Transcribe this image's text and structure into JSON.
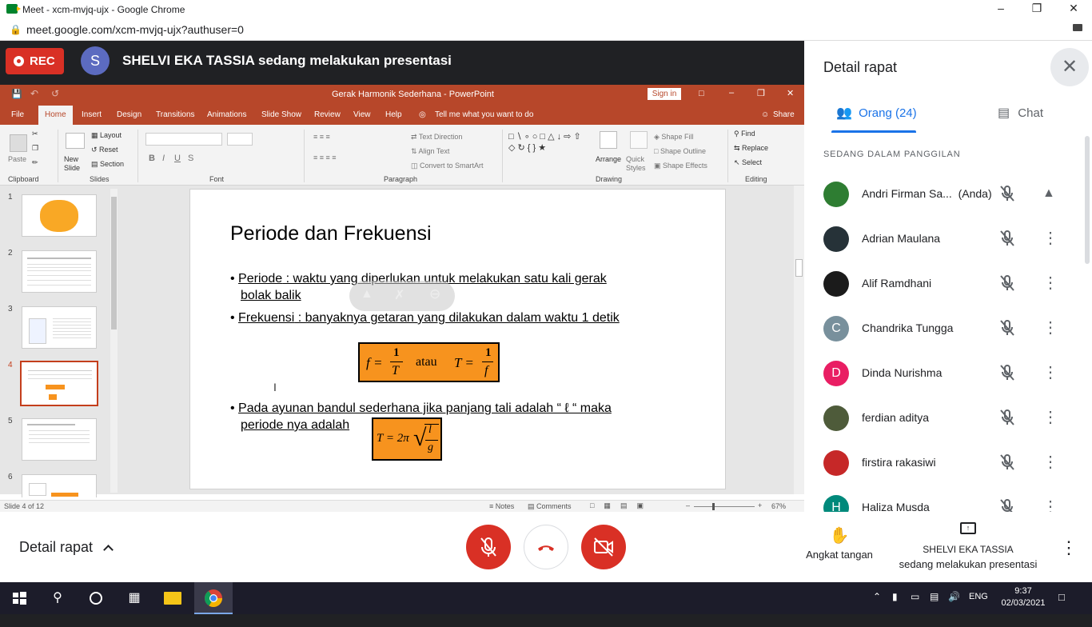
{
  "browser": {
    "title": "Meet - xcm-mvjq-ujx - Google Chrome",
    "url": "meet.google.com/xcm-mvjq-ujx?authuser=0"
  },
  "meet": {
    "rec_label": "REC",
    "presenter_initial": "S",
    "presenter_banner": "SHELVI EKA TASSIA sedang melakukan presentasi"
  },
  "ppt": {
    "window_title": "Gerak Harmonik Sederhana  -  PowerPoint",
    "sign_in": "Sign in",
    "tabs": [
      "File",
      "Home",
      "Insert",
      "Design",
      "Transitions",
      "Animations",
      "Slide Show",
      "Review",
      "View",
      "Help"
    ],
    "tell_me": "Tell me what you want to do",
    "share": "Share",
    "ribbon": {
      "paste": "Paste",
      "new_slide": "New Slide",
      "layout": "Layout",
      "reset": "Reset",
      "section": "Section",
      "text_direction": "Text Direction",
      "align_text": "Align Text",
      "convert_smartart": "Convert to SmartArt",
      "arrange": "Arrange",
      "quick_styles": "Quick Styles",
      "shape_fill": "Shape Fill",
      "shape_outline": "Shape Outline",
      "shape_effects": "Shape Effects",
      "find": "Find",
      "replace": "Replace",
      "select": "Select",
      "groups": [
        "Clipboard",
        "Slides",
        "Font",
        "Paragraph",
        "Drawing",
        "Editing"
      ]
    },
    "thumb_numbers": [
      "1",
      "2",
      "3",
      "4",
      "5",
      "6"
    ],
    "slide": {
      "title": "Periode dan Frekuensi",
      "b1_term": "Periode",
      "b1_rest": " : waktu yang diperlukan untuk melakukan satu kali gerak",
      "b1_line2": "bolak balik",
      "b2_term": "Frekuensi",
      "b2_rest": " : banyaknya getaran yang dilakukan dalam waktu 1 detik",
      "formula_f": "f =",
      "formula_num": "1",
      "formula_den_T": "T",
      "formula_atau": "atau",
      "formula_T": "T =",
      "formula_den_f": "f",
      "b3_line1": "Pada ayunan bandul sederhana jika panjang tali adalah “ ℓ “ maka",
      "b3_line2": "periode nya adalah",
      "pendulum_T": "T = 2π",
      "pendulum_l": "l",
      "pendulum_g": "g"
    },
    "status": {
      "slide_count": "Slide 4 of 12",
      "notes": "Notes",
      "comments": "Comments",
      "zoom": "67%"
    }
  },
  "panel": {
    "title": "Detail rapat",
    "tab_people": "Orang (24)",
    "tab_chat": "Chat",
    "section": "SEDANG DALAM PANGGILAN",
    "participants": [
      {
        "name": "Andri Firman Sa...",
        "suffix": "(Anda)",
        "initial": "",
        "color": "#2e7d32"
      },
      {
        "name": "Adrian Maulana",
        "initial": "",
        "color": "#263238"
      },
      {
        "name": "Alif Ramdhani",
        "initial": "",
        "color": "#1b1b1b"
      },
      {
        "name": "Chandrika Tungga",
        "initial": "C",
        "color": "#78909c"
      },
      {
        "name": "Dinda Nurishma",
        "initial": "D",
        "color": "#e91e63"
      },
      {
        "name": "ferdian aditya",
        "initial": "",
        "color": "#4e5b3a"
      },
      {
        "name": "firstira rakasiwi",
        "initial": "",
        "color": "#c62828"
      },
      {
        "name": "Haliza Musda",
        "initial": "H",
        "color": "#00897b"
      }
    ]
  },
  "bottom": {
    "details": "Detail rapat",
    "raise_hand": "Angkat tangan",
    "presenting_name": "SHELVI EKA TASSIA",
    "presenting_sub": "sedang melakukan presentasi"
  },
  "taskbar": {
    "lang": "ENG",
    "time": "9:37",
    "date": "02/03/2021"
  }
}
